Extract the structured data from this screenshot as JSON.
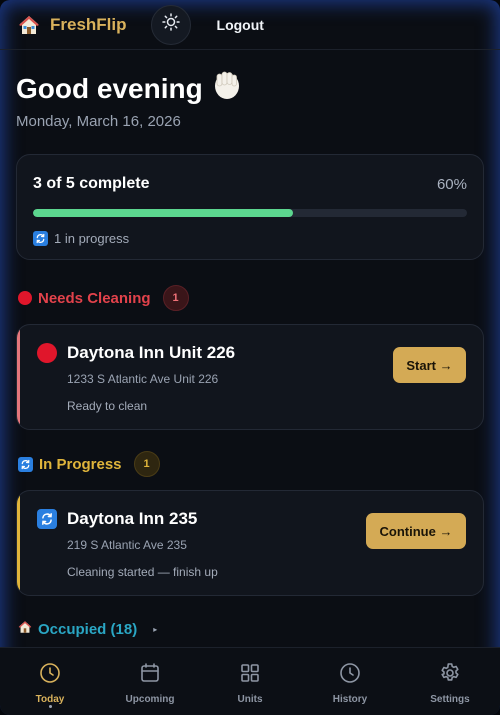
{
  "header": {
    "brand": "FreshFlip",
    "logout_label": "Logout"
  },
  "greeting": {
    "title": "Good evening",
    "date": "Monday, March 16, 2026"
  },
  "progress": {
    "title": "3 of 5 complete",
    "percent_label": "60%",
    "fraction": 0.6,
    "sub": "1 in progress"
  },
  "sections": {
    "needs_cleaning": {
      "label": "Needs Cleaning",
      "count": "1",
      "color": "#e2424b",
      "job": {
        "title": "Daytona Inn Unit 226",
        "address": "1233 S Atlantic Ave Unit 226",
        "status": "Ready to clean",
        "button": "Start →"
      }
    },
    "in_progress": {
      "label": "In Progress",
      "count": "1",
      "color": "#e0b53b",
      "job": {
        "title": "Daytona Inn 235",
        "address": "219 S Atlantic Ave 235",
        "status": "Cleaning started — finish up",
        "button": "Continue →"
      }
    },
    "occupied": {
      "label": "Occupied (18)",
      "color": "#2aa6c4"
    }
  },
  "nav": [
    {
      "label": "Today",
      "icon": "clock-icon",
      "active": true
    },
    {
      "label": "Upcoming",
      "icon": "calendar-icon",
      "active": false
    },
    {
      "label": "Units",
      "icon": "grid-icon",
      "active": false
    },
    {
      "label": "History",
      "icon": "history-icon",
      "active": false
    },
    {
      "label": "Settings",
      "icon": "gear-icon",
      "active": false
    }
  ],
  "colors": {
    "accent": "#d9b25c",
    "progress_fill": "#5cd68f",
    "button": "#d4aa55"
  }
}
